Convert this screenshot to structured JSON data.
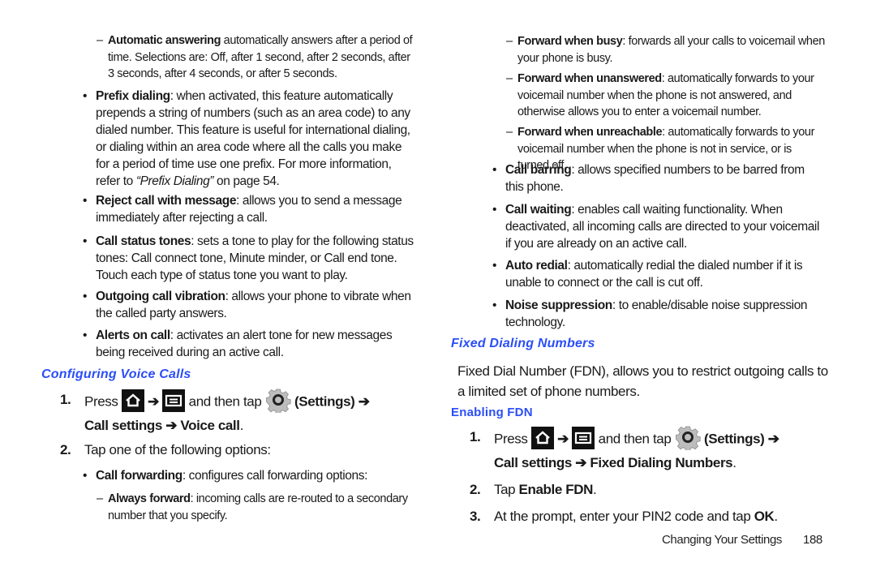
{
  "left": {
    "auto_answer": {
      "term": "Automatic answering",
      "text": " automatically answers after a period of time. Selections are: Off, after 1 second, after 2 seconds, after 3 seconds, after 4 seconds, or after 5 seconds."
    },
    "prefix_dialing": {
      "term": "Prefix dialing",
      "text": ": when activated, this feature automatically prepends a string of numbers (such as an area code) to any dialed number. This feature is useful for international dialing, or dialing within an area code where all the calls you make for a period of time use one prefix. For more information, refer to ",
      "ref": "“Prefix Dialing”",
      "ref_tail": " on page 54."
    },
    "reject_call": {
      "term": "Reject call with message",
      "text": ": allows you to send a message immediately after rejecting a call."
    },
    "call_status": {
      "term": "Call status tones",
      "text": ": sets a tone to play for the following status tones: Call connect tone, Minute minder, or Call end tone. Touch each type of status tone you want to play."
    },
    "outgoing_vibration": {
      "term": "Outgoing call vibration",
      "text": ": allows your phone to vibrate when the called party answers."
    },
    "alerts_on_call": {
      "term": "Alerts on call",
      "text": ": activates an alert tone for new messages being received during an active call."
    },
    "section_heading": "Configuring Voice Calls",
    "step1": {
      "num": "1.",
      "press": "Press",
      "arrow": "➔",
      "then_tap": "and then tap",
      "settings": "(Settings)",
      "path_a": "Call settings",
      "path_b": "Voice call",
      "end": "."
    },
    "step2": {
      "num": "2.",
      "text": "Tap one of the following options:"
    },
    "call_forwarding": {
      "term": "Call forwarding",
      "text": ": configures call forwarding options:"
    },
    "always_forward": {
      "term": "Always forward",
      "text": ": incoming calls are re-routed to a secondary number that you specify."
    }
  },
  "right": {
    "forward_busy": {
      "term": "Forward when busy",
      "text": ": forwards all your calls to voicemail when your phone is busy."
    },
    "forward_unanswered": {
      "term": "Forward when unanswered",
      "text": ": automatically forwards to your voicemail number when the phone is not answered, and otherwise allows you to enter a voicemail number."
    },
    "forward_unreachable": {
      "term": "Forward when unreachable",
      "text": ": automatically forwards to your voicemail number when the phone is not in service, or is turned off."
    },
    "call_barring": {
      "term": "Call barring",
      "text": ": allows specified numbers to be barred from this phone."
    },
    "call_waiting": {
      "term": "Call waiting",
      "text": ": enables call waiting functionality. When deactivated, all incoming calls are directed to your voicemail if you are already on an active call."
    },
    "auto_redial": {
      "term": "Auto redial",
      "text": ": automatically redial the dialed number if it is unable to connect or the call is cut off."
    },
    "noise_suppression": {
      "term": "Noise suppression",
      "text": ": to enable/disable noise suppression technology."
    },
    "section_heading": "Fixed Dialing Numbers",
    "fdn_intro": "Fixed Dial Number (FDN), allows you to restrict outgoing calls to a limited set of phone numbers.",
    "subheading": "Enabling FDN",
    "step1": {
      "num": "1.",
      "press": "Press",
      "arrow": "➔",
      "then_tap": "and then tap",
      "settings": "(Settings)",
      "path_a": "Call settings",
      "path_b": "Fixed Dialing Numbers",
      "end": "."
    },
    "step2": {
      "num": "2.",
      "pre": "Tap ",
      "term": "Enable FDN",
      "end": "."
    },
    "step3": {
      "num": "3.",
      "pre": "At the prompt, enter your PIN2 code and tap ",
      "term": "OK",
      "end": "."
    }
  },
  "footer": {
    "section": "Changing Your Settings",
    "page": "188"
  },
  "icons": {
    "home": "home-key-icon",
    "menu": "menu-key-icon",
    "settings": "settings-gear-icon"
  },
  "colors": {
    "heading": "#2b4ef7",
    "text": "#1a1a1a"
  }
}
